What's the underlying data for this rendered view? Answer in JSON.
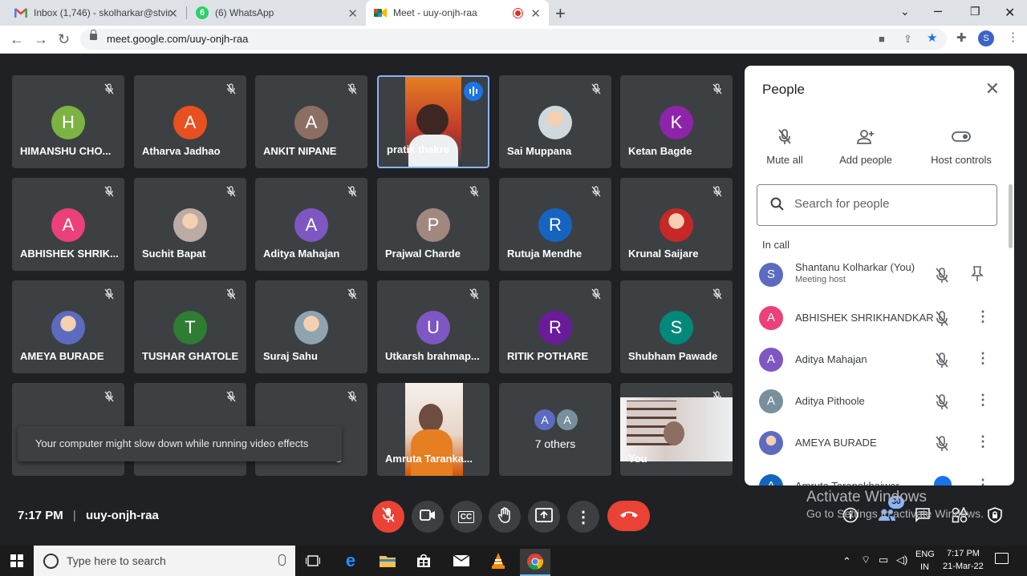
{
  "browser": {
    "tabs": [
      {
        "title": "Inbox (1,746) - skolharkar@stvinc",
        "icon": "gmail-icon"
      },
      {
        "title": "(6) WhatsApp",
        "icon": "whatsapp-icon",
        "badge": "6"
      },
      {
        "title": "Meet - uuy-onjh-raa",
        "icon": "meet-icon"
      }
    ],
    "url": "meet.google.com/uuy-onjh-raa",
    "profile_initial": "S"
  },
  "grid": {
    "tiles": [
      {
        "name": "HIMANSHU CHO...",
        "initial": "H",
        "color": "#7cb342"
      },
      {
        "name": "Atharva Jadhao",
        "initial": "A",
        "color": "#e8501f"
      },
      {
        "name": "ANKIT NIPANE",
        "initial": "A",
        "color": "#8d6e63"
      },
      {
        "name": "pratik thakre",
        "initial": "",
        "color": "#e67e22"
      },
      {
        "name": "Sai Muppana",
        "initial": "",
        "color": "#cfd8dc"
      },
      {
        "name": "Ketan Bagde",
        "initial": "K",
        "color": "#8e24aa"
      },
      {
        "name": "ABHISHEK SHRIK...",
        "initial": "A",
        "color": "#ec407a"
      },
      {
        "name": "Suchit Bapat",
        "initial": "",
        "color": "#bcaaa4"
      },
      {
        "name": "Aditya Mahajan",
        "initial": "A",
        "color": "#7e57c2"
      },
      {
        "name": "Prajwal Charde",
        "initial": "P",
        "color": "#a1887f"
      },
      {
        "name": "Rutuja Mendhe",
        "initial": "R",
        "color": "#1565c0"
      },
      {
        "name": "Krunal Saijare",
        "initial": "",
        "color": "#c62828"
      },
      {
        "name": "AMEYA BURADE",
        "initial": "",
        "color": "#5c6bc0"
      },
      {
        "name": "TUSHAR GHATOLE",
        "initial": "T",
        "color": "#2e7d32"
      },
      {
        "name": "Suraj Sahu",
        "initial": "",
        "color": "#90a4ae"
      },
      {
        "name": "Utkarsh brahmap...",
        "initial": "U",
        "color": "#7e57c2"
      },
      {
        "name": "RITIK POTHARE",
        "initial": "R",
        "color": "#6a1b9a"
      },
      {
        "name": "Shubham Pawade",
        "initial": "S",
        "color": "#00897b"
      },
      {
        "name": "",
        "initial": "",
        "color": "#c62828"
      },
      {
        "name": "",
        "initial": "",
        "color": "#0097a7"
      },
      {
        "name": "o",
        "initial": "",
        "color": "#ad1457"
      },
      {
        "name": "Amruta Taranka...",
        "initial": "",
        "color": "#d7ccc8"
      },
      {
        "name": "7 others",
        "initial": "A",
        "color": "#5c6bc0"
      },
      {
        "name": "You",
        "initial": "",
        "color": "#eeeeee"
      }
    ],
    "toast": "Your computer might slow down while running video effects"
  },
  "people": {
    "title": "People",
    "actions": [
      "Mute all",
      "Add people",
      "Host controls"
    ],
    "search_placeholder": "Search for people",
    "section": "In call",
    "list": [
      {
        "name": "Shantanu Kolharkar (You)",
        "sub": "Meeting host",
        "initial": "S",
        "color": "#5c6bc0"
      },
      {
        "name": "ABHISHEK SHRIKHANDKAR",
        "sub": "",
        "initial": "A",
        "color": "#ec407a"
      },
      {
        "name": "Aditya Mahajan",
        "sub": "",
        "initial": "A",
        "color": "#7e57c2"
      },
      {
        "name": "Aditya Pithoole",
        "sub": "",
        "initial": "A",
        "color": "#78909c"
      },
      {
        "name": "AMEYA BURADE",
        "sub": "",
        "initial": "",
        "color": "#5c6bc0"
      },
      {
        "name": "Amruta Taranekhaiwar",
        "sub": "",
        "initial": "A",
        "color": "#1565c0"
      }
    ]
  },
  "bottom": {
    "time": "7:17 PM",
    "meeting_code": "uuy-onjh-raa",
    "participants_count": "30"
  },
  "watermark": {
    "line1": "Activate Windows",
    "line2": "Go to Settings to activate Windows."
  },
  "taskbar": {
    "search_placeholder": "Type here to search",
    "lang1": "ENG",
    "lang2": "IN",
    "time": "7:17 PM",
    "date": "21-Mar-22"
  }
}
